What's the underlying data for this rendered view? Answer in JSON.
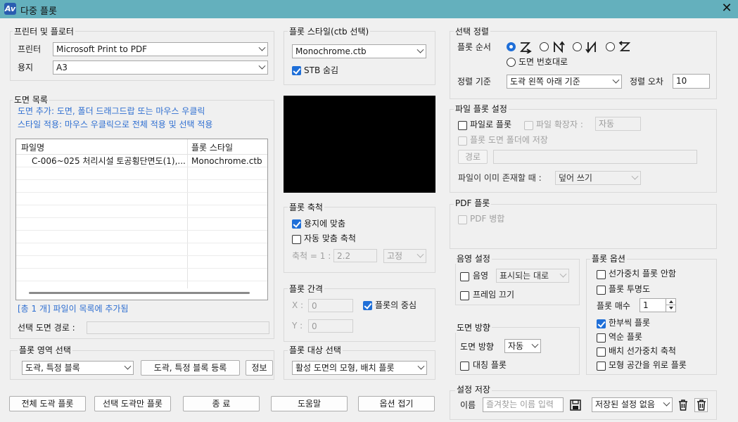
{
  "window": {
    "title": "다중 플롯",
    "app_icon": "Av"
  },
  "printer": {
    "group_title": "프린터 및 플로터",
    "printer_label": "프린터",
    "printer_value": "Microsoft Print to PDF",
    "paper_label": "용지",
    "paper_value": "A3"
  },
  "drawing_list": {
    "group_title": "도면 목록",
    "hint1": "도면 추가: 도면, 폴더 드래그드랍 또는 마우스 우클릭",
    "hint2": "스타일 적용: 마우스 우클릭으로 전체 적용 및 선택 적용",
    "columns": [
      "파일명",
      "플롯 스타일"
    ],
    "rows": [
      {
        "file": "C-006~025 처리시설 토공횡단면도(1),...",
        "style": "Monochrome.ctb"
      }
    ],
    "count_text": "[총 1 개] 파일이 목록에 추가됨",
    "path_label": "선택 도면 경로 :",
    "path_value": ""
  },
  "plot_area": {
    "group_title": "플롯 영역 선택",
    "select_value": "도곽, 특정 블록",
    "register_button": "도곽, 특정 블록 등록",
    "info_button": "정보"
  },
  "bottom_buttons": {
    "plot_all": "전체 도곽 플롯",
    "plot_selected": "선택 도곽만 플롯",
    "exit": "종 료",
    "help": "도움말",
    "collapse": "옵션 접기"
  },
  "plot_style": {
    "group_title": "플롯 스타일(ctb 선택)",
    "value": "Monochrome.ctb",
    "hide_stb_label": "STB 숨김",
    "hide_stb_checked": true
  },
  "plot_scale": {
    "group_title": "플롯 축척",
    "fit_label": "용지에 맞춤",
    "fit_checked": true,
    "auto_label": "자동 맞춤 축척",
    "auto_checked": false,
    "scale_label": "축척 = 1 :",
    "scale_value": "2.2",
    "mode_value": "고정"
  },
  "plot_offset": {
    "group_title": "플롯 간격",
    "x_label": "X :",
    "x_value": "0",
    "y_label": "Y :",
    "y_value": "0",
    "center_label": "플롯의 중심",
    "center_checked": true
  },
  "plot_target": {
    "group_title": "플롯 대상 선택",
    "value": "활성 도면의 모형, 배치 플롯"
  },
  "sort": {
    "group_title": "선택 정렬",
    "order_label": "플롯 순서",
    "by_number_label": "도면 번호대로",
    "criteria_label": "정렬 기준",
    "criteria_value": "도곽 왼쪽 아래 기준",
    "tolerance_label": "정렬 오차",
    "tolerance_value": "10"
  },
  "file_plot": {
    "group_title": "파일 플롯 설정",
    "to_file_label": "파일로 플롯",
    "ext_label": "파일 확장자 :",
    "ext_value": "자동",
    "save_in_folder_label": "플롯 도면 폴더에 저장",
    "path_button": "경로",
    "exists_label": "파일이 이미 존재할 때 :",
    "exists_value": "덮어 쓰기"
  },
  "pdf": {
    "group_title": "PDF 플롯",
    "merge_label": "PDF 병합"
  },
  "shade": {
    "group_title": "음영 설정",
    "shade_label": "음영",
    "shade_value": "표시되는 대로",
    "frame_off_label": "프레임 끄기"
  },
  "orientation": {
    "group_title": "도면 방향",
    "label": "도면 방향",
    "value": "자동",
    "mirror_label": "대칭 플롯"
  },
  "plot_options": {
    "group_title": "플롯 옵션",
    "opt1": "선가중치 플롯 안함",
    "opt2": "플롯 투명도",
    "copies_label": "플롯 매수",
    "copies_value": "1",
    "opt3": "한부씩 플롯",
    "opt4": "역순 플롯",
    "opt5": "배치 선가중치 축척",
    "opt6": "모형 공간을 위로 플롯"
  },
  "save_settings": {
    "group_title": "설정 저장",
    "name_label": "이름",
    "name_placeholder": "즐겨찾는 이름 입력",
    "saved_value": "저장된 설정 없음"
  },
  "colors": {
    "titlebar": "#64b0bd",
    "accent": "#1f6fd8",
    "hint_text": "#2f6fd1"
  }
}
